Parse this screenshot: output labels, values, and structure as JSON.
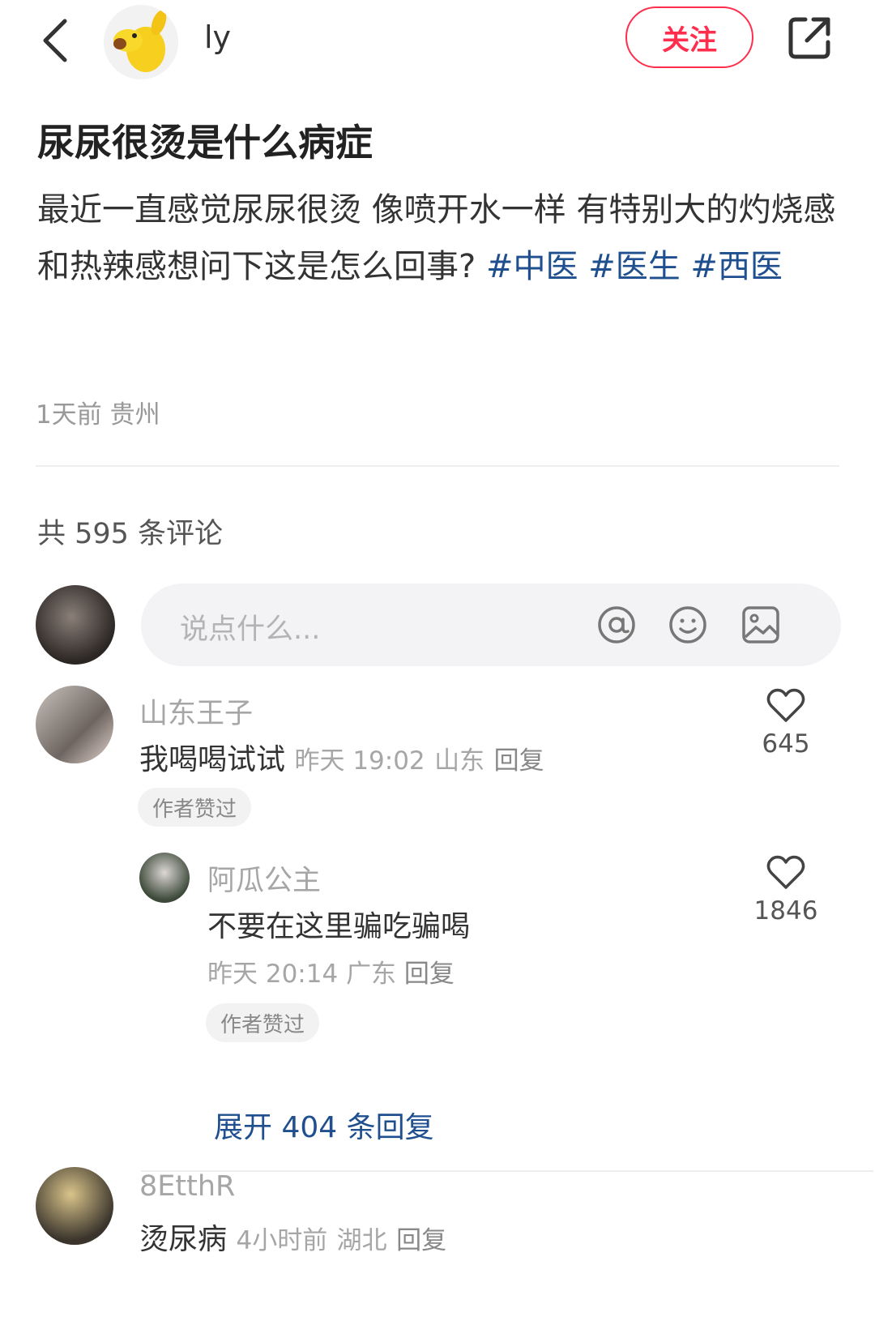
{
  "header": {
    "author_name": "ly",
    "follow_label": "关注"
  },
  "post": {
    "title": "尿尿很烫是什么病症",
    "body_text": "最近一直感觉尿尿很烫 像喷开水一样 有特别大的灼烧感和热辣感想问下这是怎么回事?",
    "tags": [
      "#中医",
      "#医生",
      "#西医"
    ],
    "time": "1天前",
    "location": "贵州"
  },
  "comments_header": {
    "total_label": "共 595 条评论"
  },
  "input": {
    "placeholder": "说点什么..."
  },
  "comments": [
    {
      "user": "山东王子",
      "text": "我喝喝试试",
      "time": "昨天 19:02",
      "location": "山东",
      "reply_label": "回复",
      "likes": "645",
      "badge": "作者赞过"
    },
    {
      "user": "阿瓜公主",
      "text": "不要在这里骗吃骗喝",
      "time": "昨天 20:14",
      "location": "广东",
      "reply_label": "回复",
      "likes": "1846",
      "badge": "作者赞过"
    },
    {
      "user": "8EtthR",
      "text": "烫尿病",
      "time": "4小时前",
      "location": "湖北",
      "reply_label": "回复"
    }
  ],
  "expand_label": "展开 404 条回复",
  "colors": {
    "accent_red": "#ff2e4d",
    "tag_blue": "#1f4f8f",
    "muted_gray": "#a6a6a6"
  }
}
